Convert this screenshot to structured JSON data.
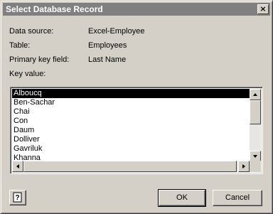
{
  "dialog": {
    "title": "Select Database Record",
    "close_glyph": "×"
  },
  "fields": {
    "data_source": {
      "label": "Data source:",
      "value": "Excel-Employee"
    },
    "table": {
      "label": "Table:",
      "value": "Employees"
    },
    "primary_key": {
      "label": "Primary key field:",
      "value": "Last Name"
    },
    "key_value_label": "Key value:"
  },
  "list": {
    "items": [
      "Alboucq",
      "Ben-Sachar",
      "Chai",
      "Con",
      "Daum",
      "Dolliver",
      "Gavriluk",
      "Khanna"
    ],
    "selected_index": 0
  },
  "buttons": {
    "help_icon": "help-icon",
    "ok": "OK",
    "cancel": "Cancel"
  }
}
